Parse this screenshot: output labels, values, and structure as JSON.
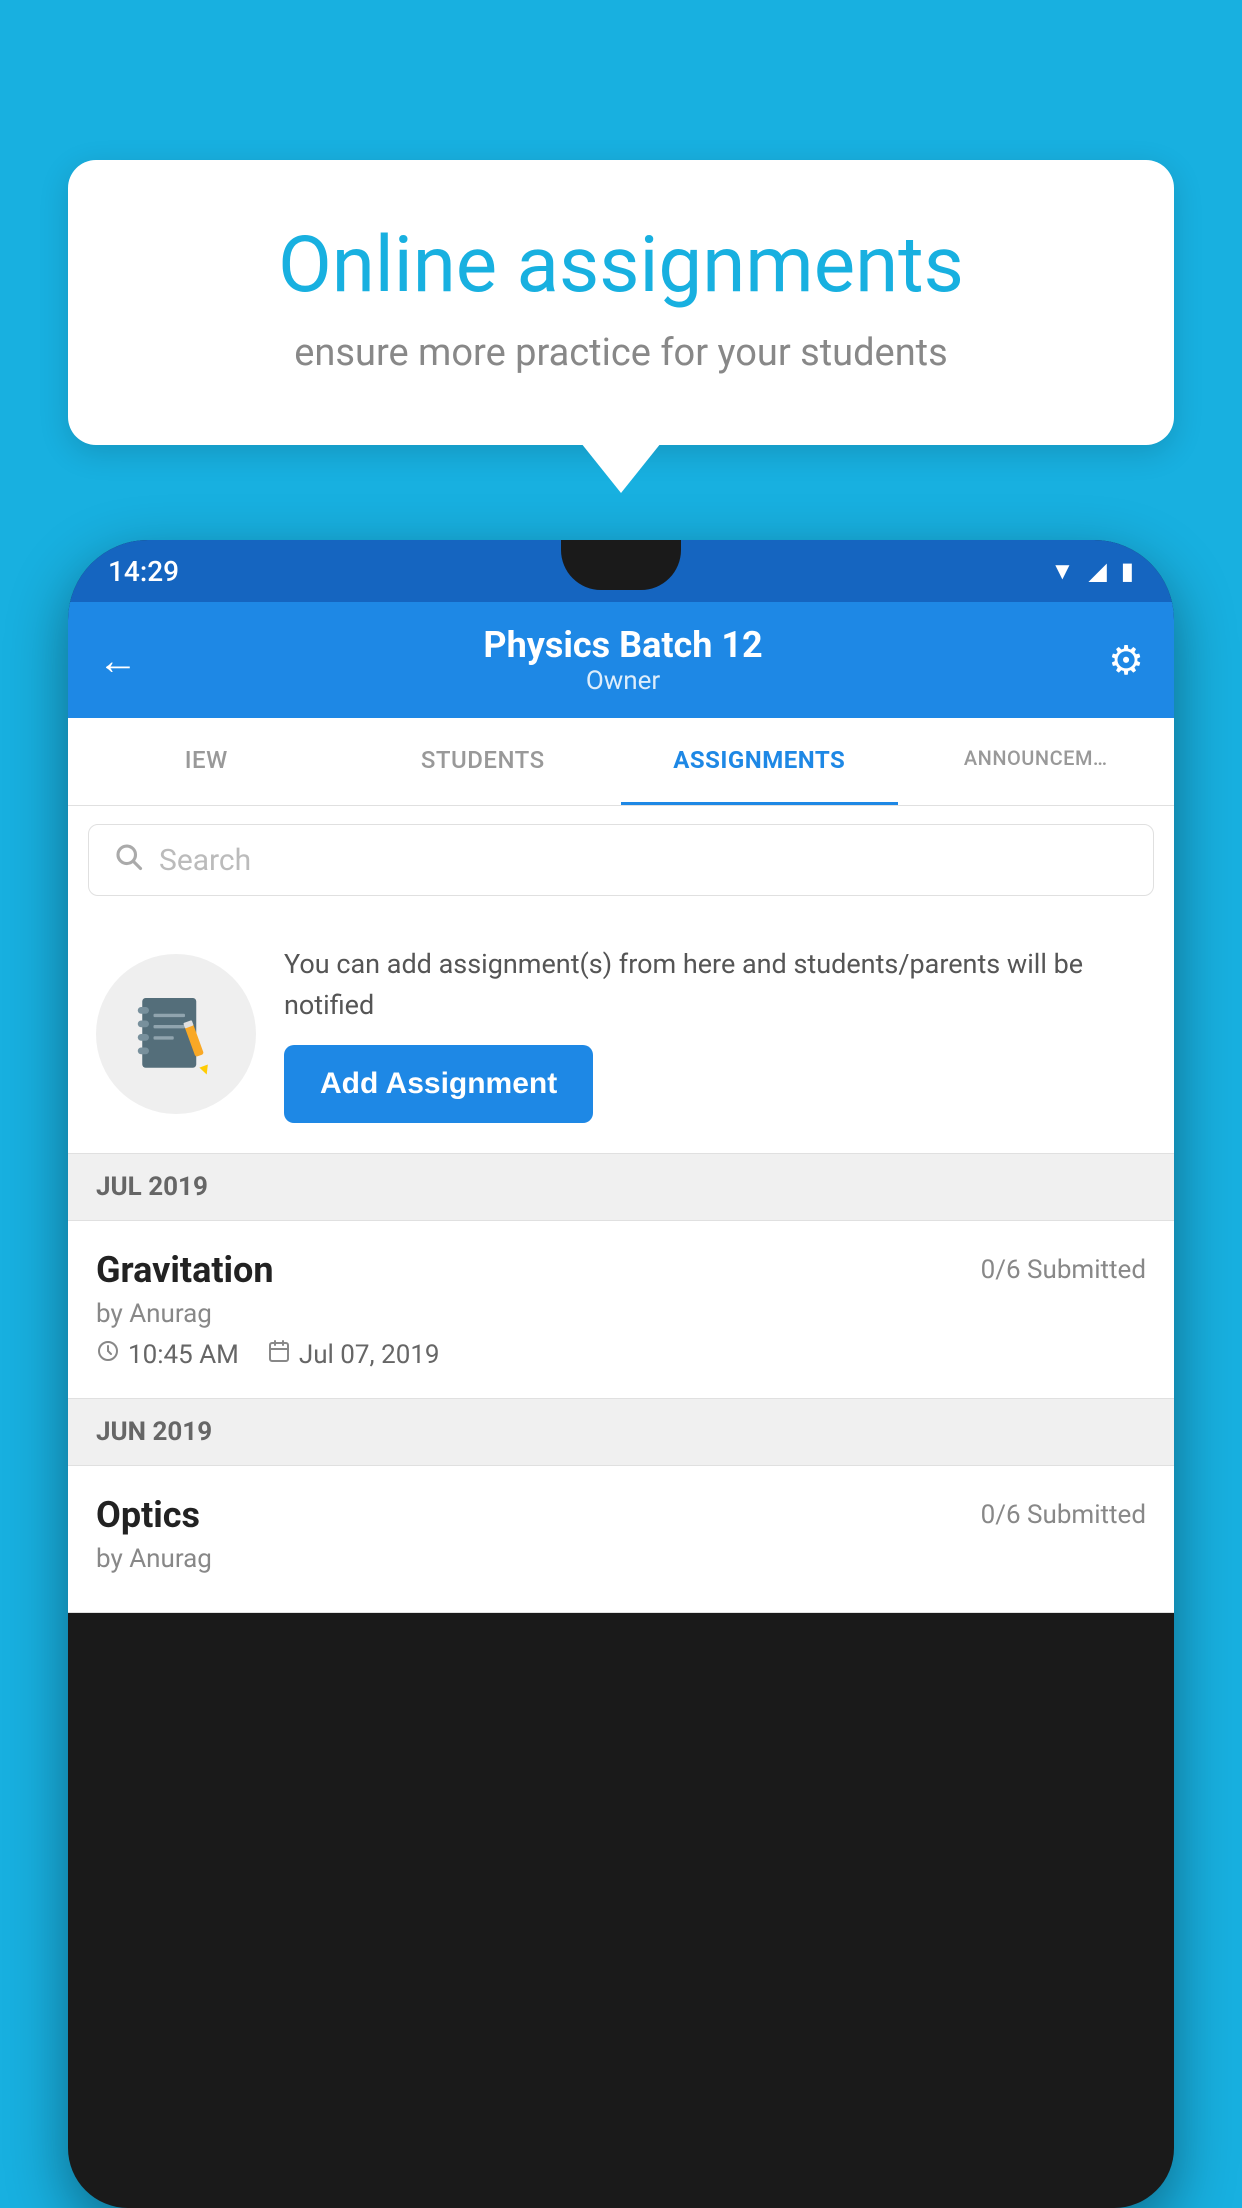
{
  "background_color": "#18b0e0",
  "speech_bubble": {
    "title": "Online assignments",
    "subtitle": "ensure more practice for your students"
  },
  "status_bar": {
    "time": "14:29",
    "wifi_icon": "wifi",
    "signal_icon": "signal",
    "battery_icon": "battery"
  },
  "app_header": {
    "back_label": "←",
    "title": "Physics Batch 12",
    "subtitle": "Owner",
    "gear_label": "⚙"
  },
  "tabs": [
    {
      "label": "IEW",
      "active": false
    },
    {
      "label": "STUDENTS",
      "active": false
    },
    {
      "label": "ASSIGNMENTS",
      "active": true
    },
    {
      "label": "ANNOUNCEM…",
      "active": false
    }
  ],
  "search": {
    "placeholder": "Search"
  },
  "promo": {
    "text": "You can add assignment(s) from here and students/parents will be notified",
    "button_label": "Add Assignment"
  },
  "sections": [
    {
      "month": "JUL 2019",
      "assignments": [
        {
          "name": "Gravitation",
          "submitted": "0/6 Submitted",
          "by": "by Anurag",
          "time": "10:45 AM",
          "date": "Jul 07, 2019"
        }
      ]
    },
    {
      "month": "JUN 2019",
      "assignments": [
        {
          "name": "Optics",
          "submitted": "0/6 Submitted",
          "by": "by Anurag",
          "time": "",
          "date": ""
        }
      ]
    }
  ]
}
